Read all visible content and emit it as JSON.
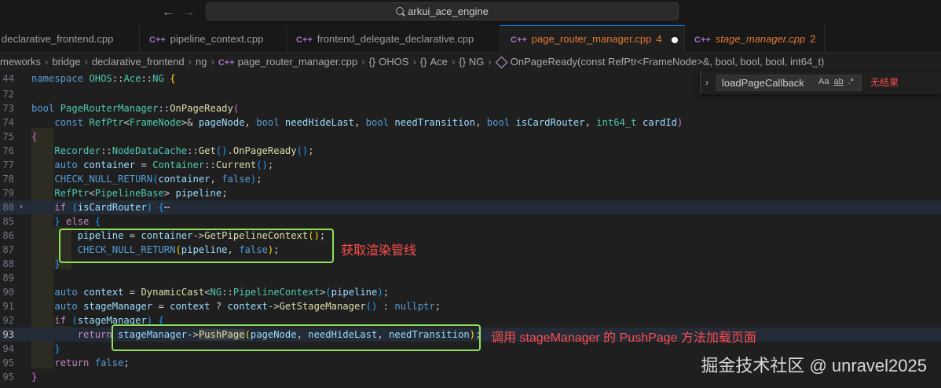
{
  "titlebar": {
    "back_glyph": "←",
    "forward_glyph": "→",
    "search_text": "arkui_ace_engine"
  },
  "tabs": [
    {
      "icon": "",
      "label": "declarative_frontend.cpp",
      "count": "",
      "state": "normal"
    },
    {
      "icon": "C++",
      "label": "pipeline_context.cpp",
      "count": "",
      "state": "normal"
    },
    {
      "icon": "C++",
      "label": "frontend_delegate_declarative.cpp",
      "count": "",
      "state": "normal"
    },
    {
      "icon": "C++",
      "label": "page_router_manager.cpp",
      "count": "4",
      "state": "active-modified"
    },
    {
      "icon": "C++",
      "label": "stage_manager.cpp",
      "count": "2",
      "state": "preview"
    }
  ],
  "breadcrumb": {
    "items": [
      "meworks",
      "bridge",
      "declarative_frontend",
      "ng"
    ],
    "file_icon": "C++",
    "file": "page_router_manager.cpp",
    "namespace_icon": "{}",
    "namespaces": [
      "OHOS",
      "Ace",
      "NG"
    ],
    "symbol": "OnPageReady(const RefPtr<FrameNode>&, bool, bool, bool, int64_t)"
  },
  "find": {
    "toggle_glyph": "›",
    "query": "loadPageCallback",
    "opt_case": "Aa",
    "opt_word": "ab",
    "opt_regex": ".*",
    "no_results": "无结果"
  },
  "code": {
    "line_numbers": [
      "44",
      "72",
      "73",
      "74",
      "75",
      "76",
      "77",
      "78",
      "79",
      "80",
      "85",
      "86",
      "87",
      "88",
      "89",
      "90",
      "91",
      "92",
      "93",
      "94",
      "95"
    ],
    "current_line": "92",
    "fold_glyph": "›",
    "ellipsis": "⋯"
  },
  "annotations": {
    "render_pipeline": "获取渲染管线",
    "push_page": "调用 stageManager 的 PushPage 方法加载页面"
  },
  "watermark": "掘金技术社区 @ unravel2025",
  "colors": {
    "active_tab_text": "#e37933",
    "annotation_box": "#8fe35a",
    "annotation_text": "#ff4d4d"
  }
}
